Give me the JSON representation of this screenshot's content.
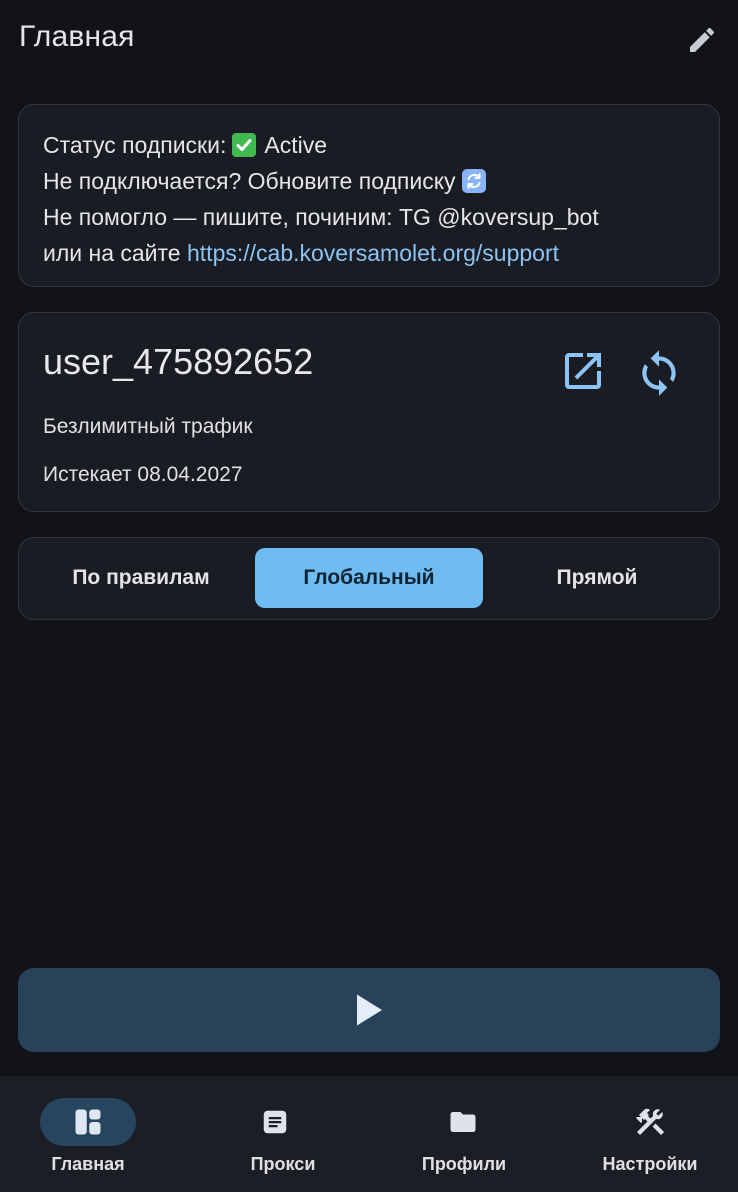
{
  "header": {
    "title": "Главная",
    "edit_icon": "pencil-icon"
  },
  "info": {
    "status_label": "Статус подписки:",
    "status_value": "Active",
    "status_icon": "check-mark-emoji",
    "line2": "Не подключается? Обновите подписку",
    "line2_icon": "refresh-emoji",
    "line3": "Не помогло — пишите, починим: TG @koversup_bot",
    "line4_prefix": "или на сайте ",
    "support_link": "https://cab.koversamolet.org/support"
  },
  "profile": {
    "name": "user_475892652",
    "traffic": "Безлимитный трафик",
    "expires": "Истекает 08.04.2027",
    "open_icon": "open-in-new-icon",
    "sync_icon": "sync-icon"
  },
  "mode": {
    "options": [
      "По правилам",
      "Глобальный",
      "Прямой"
    ],
    "selected": "Глобальный"
  },
  "connect": {
    "icon": "play-icon"
  },
  "nav": {
    "items": [
      {
        "label": "Главная",
        "icon": "dashboard-icon",
        "active": true
      },
      {
        "label": "Прокси",
        "icon": "document-icon",
        "active": false
      },
      {
        "label": "Профили",
        "icon": "folder-icon",
        "active": false
      },
      {
        "label": "Настройки",
        "icon": "tools-icon",
        "active": false
      }
    ]
  },
  "colors": {
    "background": "#111318",
    "card": "#191c22",
    "accent": "#6ebcf2",
    "link": "#8cc4f5",
    "connect_button": "#28425a",
    "nav_active": "#27455f"
  }
}
